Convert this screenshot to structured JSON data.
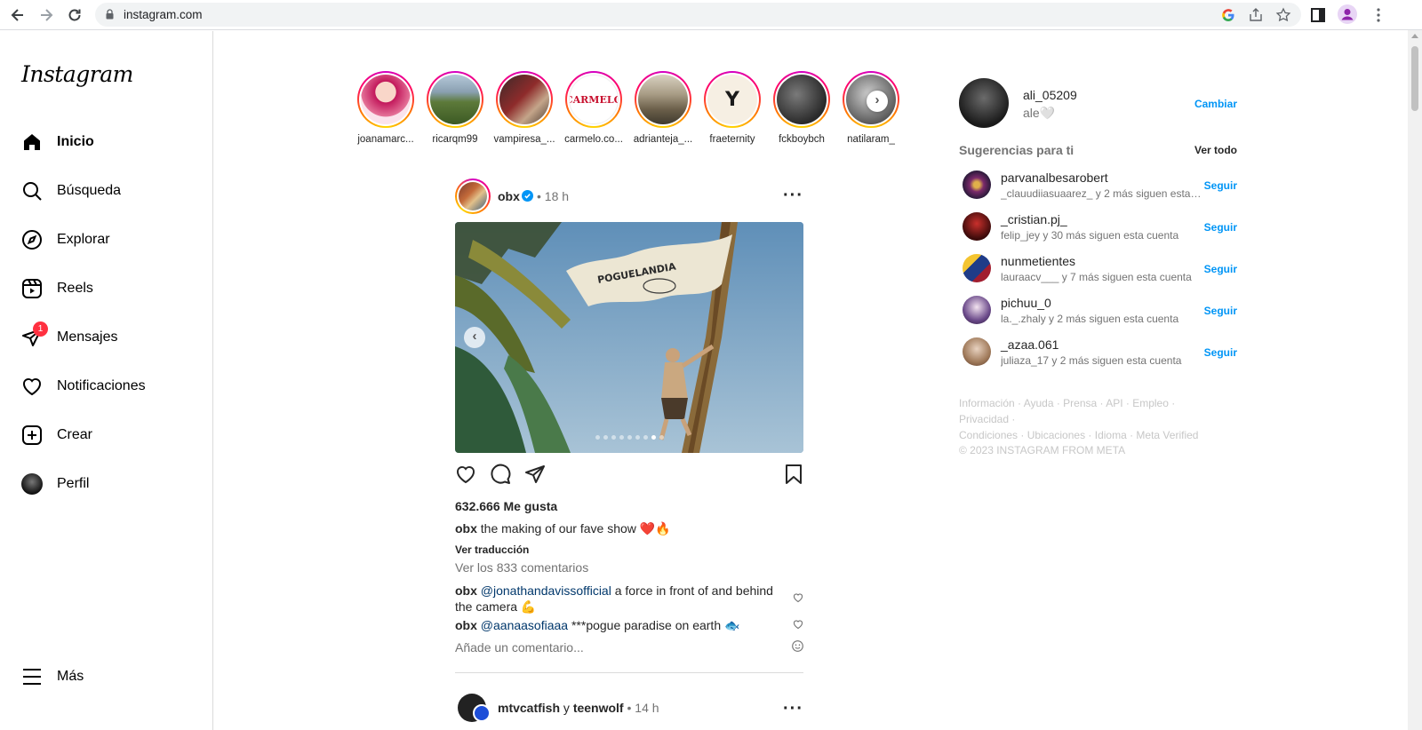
{
  "browser": {
    "url": "instagram.com"
  },
  "sidebar": {
    "logo": "Instagram",
    "items": [
      {
        "label": "Inicio",
        "icon": "home-icon",
        "active": true
      },
      {
        "label": "Búsqueda",
        "icon": "search-icon"
      },
      {
        "label": "Explorar",
        "icon": "compass-icon"
      },
      {
        "label": "Reels",
        "icon": "reels-icon"
      },
      {
        "label": "Mensajes",
        "icon": "messenger-icon",
        "badge": "1"
      },
      {
        "label": "Notificaciones",
        "icon": "heart-icon"
      },
      {
        "label": "Crear",
        "icon": "plus-square-icon"
      },
      {
        "label": "Perfil",
        "icon": "avatar"
      }
    ],
    "more": "Más"
  },
  "stories": [
    {
      "name": "joanamarc..."
    },
    {
      "name": "ricarqm99"
    },
    {
      "name": "vampiresa_..."
    },
    {
      "name": "carmelo.co..."
    },
    {
      "name": "adrianteja_..."
    },
    {
      "name": "fraeternity"
    },
    {
      "name": "fckboybch"
    },
    {
      "name": "natilaram_"
    }
  ],
  "post": {
    "user": "obx",
    "time": "18 h",
    "likes": "632.666 Me gusta",
    "caption_user": "obx",
    "caption_text": "the making of our fave show ❤️🔥",
    "translate": "Ver traducción",
    "view_comments": "Ver los 833 comentarios",
    "comments": [
      {
        "user": "obx",
        "mention": "@jonathandavissofficial",
        "text": "a force in front of and behind the camera 💪"
      },
      {
        "user": "obx",
        "mention": "@aanaasofiaaa",
        "text": "***pogue paradise on earth 🐟"
      }
    ],
    "add_comment_placeholder": "Añade un comentario...",
    "flag_text": "POGUELANDIA",
    "carousel_index": 8,
    "carousel_total": 9
  },
  "post2": {
    "user1": "mtvcatfish",
    "conj": "y",
    "user2": "teenwolf",
    "time": "14 h"
  },
  "right": {
    "username": "ali_05209",
    "name": "ale🤍",
    "switch": "Cambiar",
    "suggest_title": "Sugerencias para ti",
    "see_all": "Ver todo",
    "suggestions": [
      {
        "user": "parvanalbesarobert",
        "sub": "_clauudiiasuaarez_ y 2 más siguen esta cu...",
        "follow": "Seguir"
      },
      {
        "user": "_cristian.pj_",
        "sub": "felip_jey y 30 más siguen esta cuenta",
        "follow": "Seguir"
      },
      {
        "user": "nunmetientes",
        "sub": "lauraacv___ y 7 más siguen esta cuenta",
        "follow": "Seguir"
      },
      {
        "user": "pichuu_0",
        "sub": "la._.zhaly y 2 más siguen esta cuenta",
        "follow": "Seguir"
      },
      {
        "user": "_azaa.061",
        "sub": "juliaza_17 y 2 más siguen esta cuenta",
        "follow": "Seguir"
      }
    ],
    "footer_line1": "Información · Ayuda · Prensa · API · Empleo · Privacidad ·",
    "footer_line2": "Condiciones · Ubicaciones · Idioma · Meta Verified",
    "copyright": "© 2023 INSTAGRAM FROM META"
  },
  "colors": {
    "accent": "#0095f6",
    "badge": "#ff3040"
  }
}
